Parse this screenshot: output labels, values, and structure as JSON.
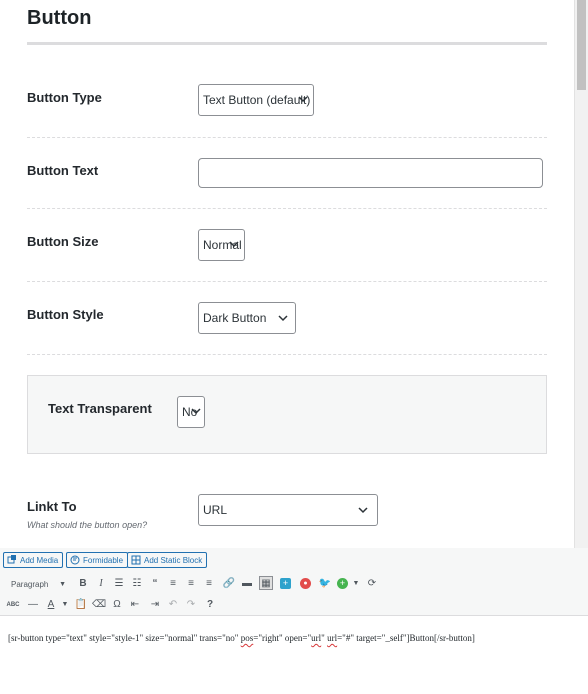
{
  "section": {
    "title": "Button"
  },
  "fields": {
    "button_type": {
      "label": "Button Type",
      "value": "Text Button (default)"
    },
    "button_text": {
      "label": "Button Text",
      "value": ""
    },
    "button_size": {
      "label": "Button Size",
      "value": "Normal"
    },
    "button_style": {
      "label": "Button Style",
      "value": "Dark Button"
    },
    "text_transparent": {
      "label": "Text Transparent",
      "value": "No"
    },
    "link_to": {
      "label": "Linkt To",
      "description": "What should the button open?",
      "value": "URL"
    }
  },
  "editor": {
    "media_buttons": [
      "Add Media",
      "Formidable",
      "Add Static Block"
    ],
    "format_select": "Paragraph",
    "toolbar_row1_icons": [
      "bold-icon",
      "italic-icon",
      "bullet-list-icon",
      "numbered-list-icon",
      "blockquote-icon",
      "align-left-icon",
      "align-center-icon",
      "align-right-icon",
      "link-icon",
      "read-more-icon",
      "toolbar-toggle-icon",
      "plus-square-icon",
      "circle-red-icon",
      "twitter-icon",
      "add-circle-icon",
      "refresh-icon"
    ],
    "toolbar_row2_icons": [
      "spellcheck-icon",
      "horizontal-line-icon",
      "text-color-icon",
      "paste-text-icon",
      "clear-format-icon",
      "special-char-icon",
      "outdent-icon",
      "indent-icon",
      "undo-icon",
      "redo-icon",
      "help-icon"
    ],
    "content": {
      "part1": "[sr-button type=\"text\" style=\"style-1\" size=\"normal\" trans=\"no\" ",
      "pos": "pos",
      "part2": "=\"right\" open=\"",
      "url1": "url",
      "part3": "\" ",
      "url2": "url",
      "part4": "=\"#\" target=\"_self\"]Button[/sr-button]"
    }
  },
  "colors": {
    "accent": "#2271b1",
    "text": "#23282d",
    "border": "#8c8f94"
  }
}
